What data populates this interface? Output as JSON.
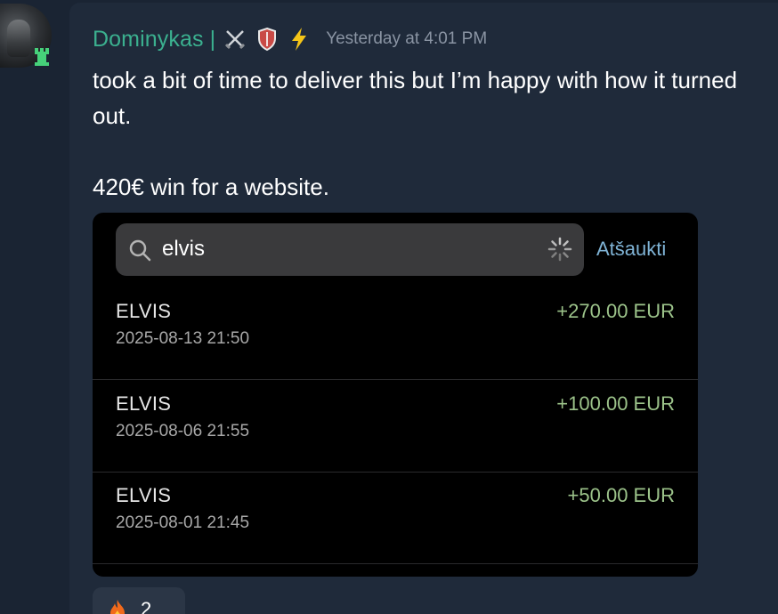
{
  "message": {
    "author": "Dominykas |",
    "author_badges": [
      "crossed-swords-icon",
      "shield-icon",
      "lightning-icon"
    ],
    "timestamp": "Yesterday at 4:01 PM",
    "text": "took a bit of time to deliver this but I’m happy with how it turned out.\n\n420€ win for a website.",
    "colors": {
      "author": "#3bb08f",
      "amount_positive": "#9cc38a",
      "cancel_link": "#7fb3d5"
    }
  },
  "embedded_screenshot": {
    "search": {
      "value": "elvis",
      "cancel_label": "Atšaukti"
    },
    "transactions": [
      {
        "name": "ELVIS",
        "date": "2025-08-13 21:50",
        "amount": "+270.00 EUR"
      },
      {
        "name": "ELVIS",
        "date": "2025-08-06 21:55",
        "amount": "+100.00 EUR"
      },
      {
        "name": "ELVIS",
        "date": "2025-08-01 21:45",
        "amount": "+50.00 EUR"
      }
    ]
  },
  "reaction": {
    "icon": "fire-icon",
    "count": "2"
  }
}
